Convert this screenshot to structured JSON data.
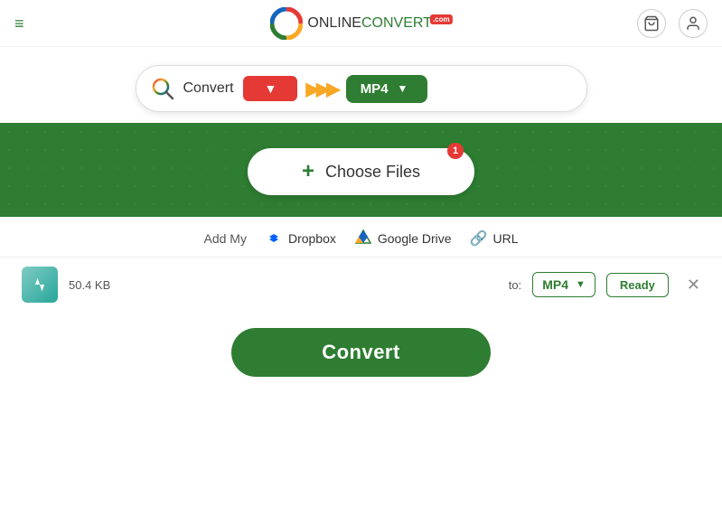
{
  "header": {
    "logo_online": "ONLINE",
    "logo_convert": "CONVERT",
    "logo_com": ".com",
    "hamburger": "≡"
  },
  "search_bar": {
    "convert_label": "Convert",
    "format_source": "",
    "arrow_chevrons": ">>>",
    "format_target": "MP4"
  },
  "drop_zone": {
    "choose_files_label": "Choose Files",
    "badge": "1",
    "add_my_label": "Add My",
    "dropbox_label": "Dropbox",
    "gdrive_label": "Google Drive",
    "url_label": "URL"
  },
  "file_item": {
    "file_size": "50.4 KB",
    "to_label": "to:",
    "format": "MP4",
    "status": "Ready"
  },
  "convert_button": {
    "label": "Convert"
  }
}
